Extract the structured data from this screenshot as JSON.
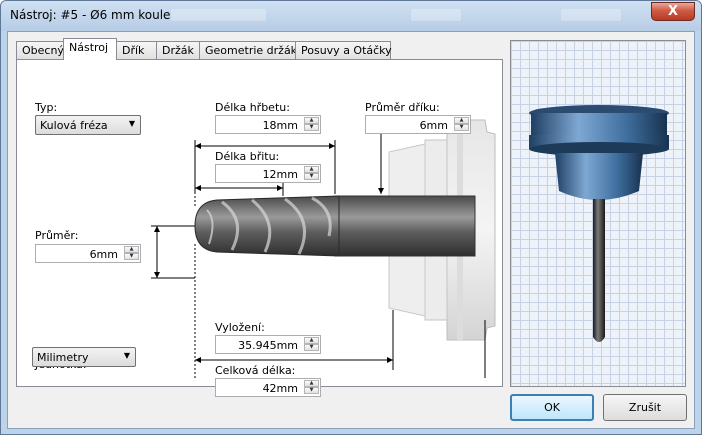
{
  "window": {
    "title": "Nástroj: #5 - Ø6 mm koule",
    "close_label": "X"
  },
  "tabs": [
    {
      "label": "Obecný"
    },
    {
      "label": "Nástroj"
    },
    {
      "label": "Dřík"
    },
    {
      "label": "Držák"
    },
    {
      "label": "Geometrie držáku"
    },
    {
      "label": "Posuvy a Otáčky"
    }
  ],
  "fields": {
    "typ": {
      "label": "Typ:",
      "value": "Kulová fréza"
    },
    "delka_hrbetu": {
      "label": "Délka hřbetu:",
      "value": "18mm"
    },
    "prumer_driku": {
      "label": "Průměr dříku:",
      "value": "6mm"
    },
    "delka_britu": {
      "label": "Délka břitu:",
      "value": "12mm"
    },
    "prumer": {
      "label": "Průměr:",
      "value": "6mm"
    },
    "vylozeni": {
      "label": "Vyložení:",
      "value": "35.945mm"
    },
    "celkova_delka": {
      "label": "Celková délka:",
      "value": "42mm"
    },
    "jednotka": {
      "label": "Jednotka:",
      "value": "Milimetry"
    }
  },
  "buttons": {
    "ok": "OK",
    "cancel": "Zrušit"
  },
  "colors": {
    "holder": "#3f6f9e",
    "tool_steel": "#6b6b6b",
    "default_button_border": "#3c7fb1"
  }
}
